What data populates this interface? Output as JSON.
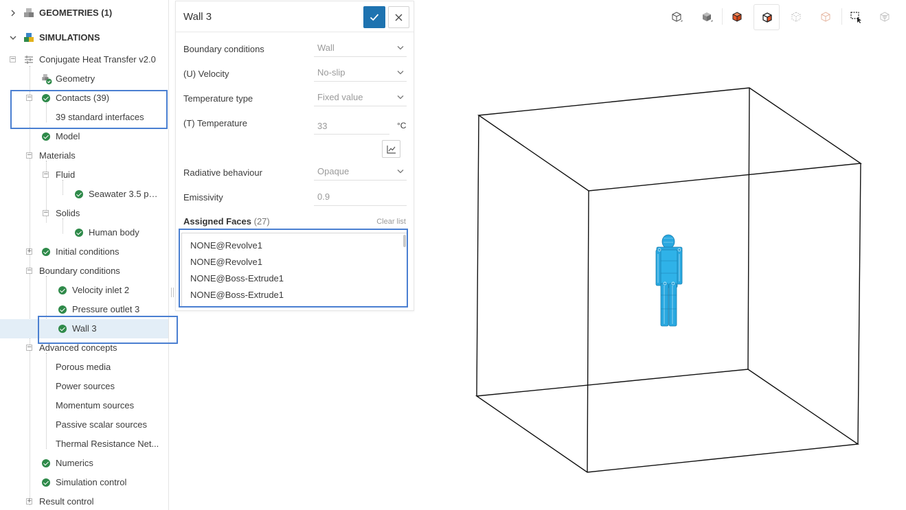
{
  "tree": {
    "geometries_label": "GEOMETRIES (1)",
    "simulations_label": "SIMULATIONS",
    "project_label": "Conjugate Heat Transfer v2.0",
    "geometry_label": "Geometry",
    "contacts_label": "Contacts (39)",
    "contacts_child_label": "39 standard interfaces",
    "model_label": "Model",
    "materials_label": "Materials",
    "fluid_label": "Fluid",
    "fluid_child_label": "Seawater 3.5 pc ...",
    "solids_label": "Solids",
    "solids_child_label": "Human body",
    "initial_conditions_label": "Initial conditions",
    "boundary_conditions_label": "Boundary conditions",
    "bc_items": [
      "Velocity inlet 2",
      "Pressure outlet 3",
      "Wall 3"
    ],
    "advanced_concepts_label": "Advanced concepts",
    "advanced_items": [
      "Porous media",
      "Power sources",
      "Momentum sources",
      "Passive scalar sources",
      "Thermal Resistance Net..."
    ],
    "numerics_label": "Numerics",
    "simulation_control_label": "Simulation control",
    "result_control_label": "Result control"
  },
  "panel": {
    "title": "Wall 3",
    "boundary_conditions_label": "Boundary conditions",
    "boundary_conditions_value": "Wall",
    "velocity_label": "(U) Velocity",
    "velocity_value": "No-slip",
    "temperature_type_label": "Temperature type",
    "temperature_type_value": "Fixed value",
    "temperature_label": "(T) Temperature",
    "temperature_value": "33",
    "temperature_unit": "°C",
    "radiative_label": "Radiative behaviour",
    "radiative_value": "Opaque",
    "emissivity_label": "Emissivity",
    "emissivity_value": "0.9",
    "assigned_faces_label": "Assigned Faces",
    "assigned_faces_count": "(27)",
    "clear_list_label": "Clear list",
    "faces": [
      "NONE@Revolve1",
      "NONE@Revolve1",
      "NONE@Boss-Extrude1",
      "NONE@Boss-Extrude1"
    ]
  },
  "toolbar": {
    "icons": [
      "cube-wireframe-icon",
      "cube-solid-icon",
      "cube-surface-icon",
      "cube-edges-icon",
      "cube-points-icon",
      "cube-hidden-icon",
      "box-select-icon",
      "settings-cube-icon"
    ],
    "active_index": 3
  },
  "colors": {
    "accent": "#1e73b0",
    "check": "#2f8a4a",
    "highlight_box": "#4a7fd1",
    "model": "#29a8e0",
    "orange": "#e8572a"
  }
}
